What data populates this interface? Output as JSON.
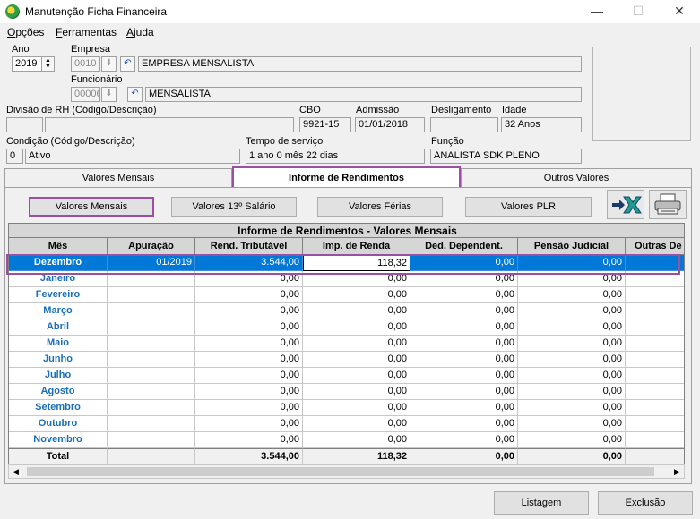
{
  "window": {
    "title": "Manutenção Ficha Financeira",
    "minimize": "—",
    "maximize": "☐",
    "close": "✕"
  },
  "menu": [
    "Opções",
    "Ferramentas",
    "Ajuda"
  ],
  "form": {
    "ano_label": "Ano",
    "ano_value": "2019",
    "empresa_label": "Empresa",
    "empresa_code": "0010",
    "empresa_name": "EMPRESA MENSALISTA",
    "funcionario_label": "Funcionário",
    "funcionario_code": "00006",
    "funcionario_name": "MENSALISTA",
    "divisao_label": "Divisão de RH (Código/Descrição)",
    "divisao_code": "",
    "divisao_desc": "",
    "cbo_label": "CBO",
    "cbo_value": "9921-15",
    "admissao_label": "Admissão",
    "admissao_value": "01/01/2018",
    "desligamento_label": "Desligamento",
    "desligamento_value": "",
    "idade_label": "Idade",
    "idade_value": "32 Anos",
    "condicao_label": "Condição (Código/Descrição)",
    "condicao_code": "0",
    "condicao_desc": "Ativo",
    "tempo_label": "Tempo de serviço",
    "tempo_value": "1 ano 0 mês 22 dias",
    "funcao_label": "Função",
    "funcao_value": "ANALISTA SDK PLENO"
  },
  "tabs": [
    "Valores Mensais",
    "Informe de Rendimentos",
    "Outros Valores"
  ],
  "subbuttons": [
    "Valores Mensais",
    "Valores 13º Salário",
    "Valores Férias",
    "Valores PLR"
  ],
  "grid": {
    "title": "Informe de Rendimentos - Valores Mensais",
    "columns": [
      "Mês",
      "Apuração",
      "Rend. Tributável",
      "Imp. de Renda",
      "Ded. Dependent.",
      "Pensão Judicial",
      "Outras De"
    ],
    "rows": [
      [
        "Dezembro",
        "01/2019",
        "3.544,00",
        "118,32",
        "0,00",
        "0,00",
        ""
      ],
      [
        "Janeiro",
        "",
        "0,00",
        "0,00",
        "0,00",
        "0,00",
        ""
      ],
      [
        "Fevereiro",
        "",
        "0,00",
        "0,00",
        "0,00",
        "0,00",
        ""
      ],
      [
        "Março",
        "",
        "0,00",
        "0,00",
        "0,00",
        "0,00",
        ""
      ],
      [
        "Abril",
        "",
        "0,00",
        "0,00",
        "0,00",
        "0,00",
        ""
      ],
      [
        "Maio",
        "",
        "0,00",
        "0,00",
        "0,00",
        "0,00",
        ""
      ],
      [
        "Junho",
        "",
        "0,00",
        "0,00",
        "0,00",
        "0,00",
        ""
      ],
      [
        "Julho",
        "",
        "0,00",
        "0,00",
        "0,00",
        "0,00",
        ""
      ],
      [
        "Agosto",
        "",
        "0,00",
        "0,00",
        "0,00",
        "0,00",
        ""
      ],
      [
        "Setembro",
        "",
        "0,00",
        "0,00",
        "0,00",
        "0,00",
        ""
      ],
      [
        "Outubro",
        "",
        "0,00",
        "0,00",
        "0,00",
        "0,00",
        ""
      ],
      [
        "Novembro",
        "",
        "0,00",
        "0,00",
        "0,00",
        "0,00",
        ""
      ]
    ],
    "total": [
      "Total",
      "",
      "3.544,00",
      "118,32",
      "0,00",
      "0,00",
      ""
    ]
  },
  "footer": {
    "listagem": "Listagem",
    "exclusao": "Exclusão"
  },
  "colors": {
    "accent": "#9b4fa3",
    "selection": "#0078d7",
    "month_text": "#1a6fb8"
  }
}
